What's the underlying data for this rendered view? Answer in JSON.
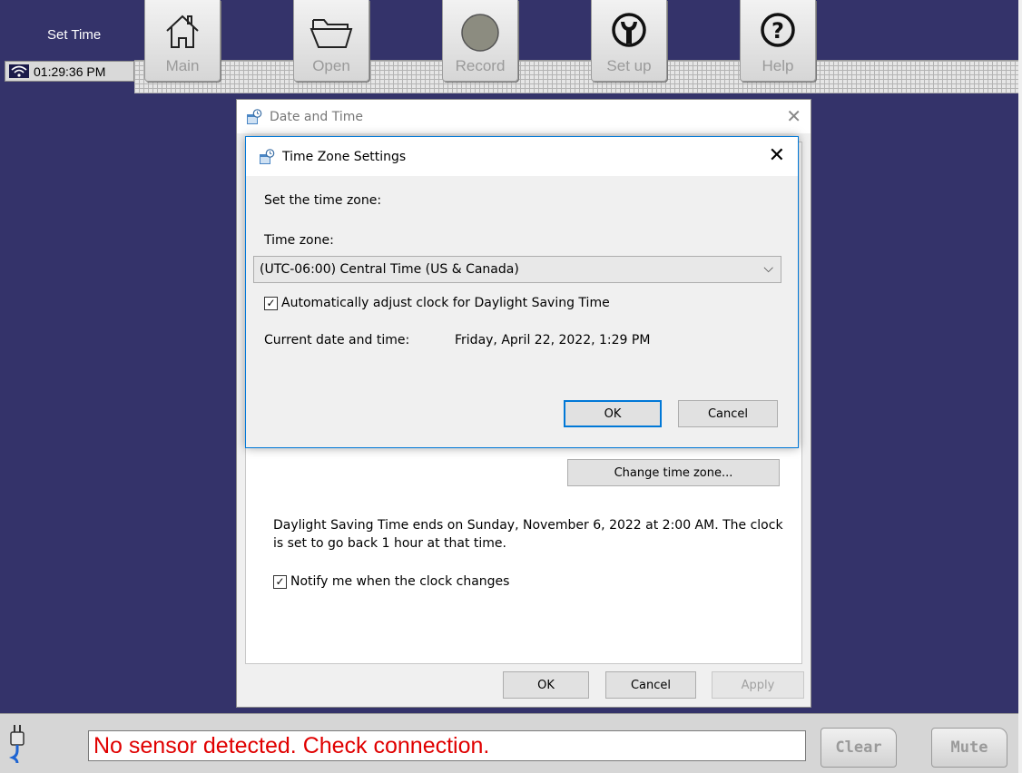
{
  "app": {
    "title": "Set Time",
    "clock": "01:29:36 PM"
  },
  "toolbar": {
    "buttons": [
      {
        "label": "Main",
        "icon": "home-icon"
      },
      {
        "label": "Open",
        "icon": "folder-icon"
      },
      {
        "label": "Record",
        "icon": "record-icon"
      },
      {
        "label": "Set up",
        "icon": "wrench-icon"
      },
      {
        "label": "Help",
        "icon": "help-icon"
      }
    ]
  },
  "date_time_dialog": {
    "title": "Date and Time",
    "change_time_zone_label": "Change time zone...",
    "dst_message": "Daylight Saving Time ends on Sunday, November 6, 2022 at 2:00 AM. The clock is set to go back 1 hour at that time.",
    "notify_label": "Notify me when the clock changes",
    "notify_checked": true,
    "ok_label": "OK",
    "cancel_label": "Cancel",
    "apply_label": "Apply"
  },
  "time_zone_dialog": {
    "title": "Time Zone Settings",
    "intro": "Set the time zone:",
    "time_zone_label": "Time zone:",
    "time_zone_value": "(UTC-06:00) Central Time (US & Canada)",
    "dst_auto_label": "Automatically adjust clock for Daylight Saving Time",
    "dst_auto_checked": true,
    "current_label": "Current date and time:",
    "current_value": "Friday, April 22, 2022, 1:29 PM",
    "ok_label": "OK",
    "cancel_label": "Cancel"
  },
  "status": {
    "message": "No sensor detected. Check connection.",
    "message_color": "#e00000",
    "clear_label": "Clear",
    "mute_label": "Mute"
  },
  "colors": {
    "background": "#34336a",
    "accent": "#0078d7"
  }
}
